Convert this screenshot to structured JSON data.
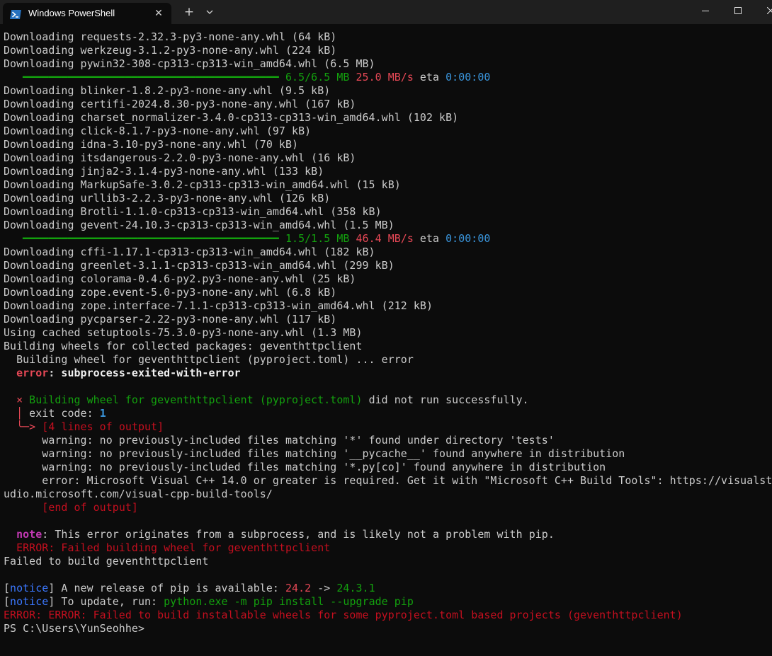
{
  "window": {
    "tab_title": "Windows PowerShell",
    "icons": {
      "tab": "powershell-icon",
      "close": "close-icon",
      "new_tab": "plus-icon",
      "dropdown": "chevron-down-icon",
      "minimize": "minimize-icon",
      "maximize": "maximize-icon",
      "window_close": "close-icon"
    },
    "close_glyph": "✕",
    "new_tab_glyph": "+"
  },
  "colors": {
    "background": "#0c0c0c",
    "titlebar": "#1f1f1f",
    "text": "#cccccc",
    "green": "#13a10e",
    "red": "#e74856",
    "dark_red": "#c50f1f",
    "cyan": "#3a96dd",
    "blue": "#0037da",
    "magenta": "#c239b3"
  },
  "terminal": {
    "lines": [
      [
        {
          "t": "Downloading requests-2.32.3-py3-none-any.whl (64 kB)",
          "c": "default"
        }
      ],
      [
        {
          "t": "Downloading werkzeug-3.1.2-py3-none-any.whl (224 kB)",
          "c": "default"
        }
      ],
      [
        {
          "t": "Downloading pywin32-308-cp313-cp313-win_amd64.whl (6.5 MB)",
          "c": "default"
        }
      ],
      [
        {
          "t": "   ━━━━━━━━━━━━━━━━━━━━━━━━━━━━━━━━━━━━━━━━ ",
          "c": "green"
        },
        {
          "t": "6.5/6.5 MB",
          "c": "green"
        },
        {
          "t": " ",
          "c": "default"
        },
        {
          "t": "25.0 MB/s",
          "c": "red"
        },
        {
          "t": " eta ",
          "c": "default"
        },
        {
          "t": "0:00:00",
          "c": "cyan"
        }
      ],
      [
        {
          "t": "Downloading blinker-1.8.2-py3-none-any.whl (9.5 kB)",
          "c": "default"
        }
      ],
      [
        {
          "t": "Downloading certifi-2024.8.30-py3-none-any.whl (167 kB)",
          "c": "default"
        }
      ],
      [
        {
          "t": "Downloading charset_normalizer-3.4.0-cp313-cp313-win_amd64.whl (102 kB)",
          "c": "default"
        }
      ],
      [
        {
          "t": "Downloading click-8.1.7-py3-none-any.whl (97 kB)",
          "c": "default"
        }
      ],
      [
        {
          "t": "Downloading idna-3.10-py3-none-any.whl (70 kB)",
          "c": "default"
        }
      ],
      [
        {
          "t": "Downloading itsdangerous-2.2.0-py3-none-any.whl (16 kB)",
          "c": "default"
        }
      ],
      [
        {
          "t": "Downloading jinja2-3.1.4-py3-none-any.whl (133 kB)",
          "c": "default"
        }
      ],
      [
        {
          "t": "Downloading MarkupSafe-3.0.2-cp313-cp313-win_amd64.whl (15 kB)",
          "c": "default"
        }
      ],
      [
        {
          "t": "Downloading urllib3-2.2.3-py3-none-any.whl (126 kB)",
          "c": "default"
        }
      ],
      [
        {
          "t": "Downloading Brotli-1.1.0-cp313-cp313-win_amd64.whl (358 kB)",
          "c": "default"
        }
      ],
      [
        {
          "t": "Downloading gevent-24.10.3-cp313-cp313-win_amd64.whl (1.5 MB)",
          "c": "default"
        }
      ],
      [
        {
          "t": "   ━━━━━━━━━━━━━━━━━━━━━━━━━━━━━━━━━━━━━━━━ ",
          "c": "green"
        },
        {
          "t": "1.5/1.5 MB",
          "c": "green"
        },
        {
          "t": " ",
          "c": "default"
        },
        {
          "t": "46.4 MB/s",
          "c": "red"
        },
        {
          "t": " eta ",
          "c": "default"
        },
        {
          "t": "0:00:00",
          "c": "cyan"
        }
      ],
      [
        {
          "t": "Downloading cffi-1.17.1-cp313-cp313-win_amd64.whl (182 kB)",
          "c": "default"
        }
      ],
      [
        {
          "t": "Downloading greenlet-3.1.1-cp313-cp313-win_amd64.whl (299 kB)",
          "c": "default"
        }
      ],
      [
        {
          "t": "Downloading colorama-0.4.6-py2.py3-none-any.whl (25 kB)",
          "c": "default"
        }
      ],
      [
        {
          "t": "Downloading zope.event-5.0-py3-none-any.whl (6.8 kB)",
          "c": "default"
        }
      ],
      [
        {
          "t": "Downloading zope.interface-7.1.1-cp313-cp313-win_amd64.whl (212 kB)",
          "c": "default"
        }
      ],
      [
        {
          "t": "Downloading pycparser-2.22-py3-none-any.whl (117 kB)",
          "c": "default"
        }
      ],
      [
        {
          "t": "Using cached setuptools-75.3.0-py3-none-any.whl (1.3 MB)",
          "c": "default"
        }
      ],
      [
        {
          "t": "Building wheels for collected packages: geventhttpclient",
          "c": "default"
        }
      ],
      [
        {
          "t": "  Building wheel for geventhttpclient (pyproject.toml) ... error",
          "c": "default"
        }
      ],
      [
        {
          "t": "  ",
          "c": "default"
        },
        {
          "t": "error",
          "c": "red",
          "b": true
        },
        {
          "t": ": ",
          "c": "default",
          "b": true
        },
        {
          "t": "subprocess-exited-with-error",
          "c": "white",
          "b": true
        }
      ],
      [
        {
          "t": "",
          "c": "default"
        }
      ],
      [
        {
          "t": "  ",
          "c": "default"
        },
        {
          "t": "×",
          "c": "red"
        },
        {
          "t": " Building wheel for geventhttpclient (pyproject.toml)",
          "c": "green"
        },
        {
          "t": " did not run successfully.",
          "c": "default"
        }
      ],
      [
        {
          "t": "  ",
          "c": "default"
        },
        {
          "t": "│",
          "c": "red"
        },
        {
          "t": " exit code: ",
          "c": "default"
        },
        {
          "t": "1",
          "c": "cyan",
          "b": true
        }
      ],
      [
        {
          "t": "  ",
          "c": "default"
        },
        {
          "t": "╰─>",
          "c": "red"
        },
        {
          "t": " [4 lines of output]",
          "c": "dred"
        }
      ],
      [
        {
          "t": "      warning: no previously-included files matching '*' found under directory 'tests'",
          "c": "default"
        }
      ],
      [
        {
          "t": "      warning: no previously-included files matching '__pycache__' found anywhere in distribution",
          "c": "default"
        }
      ],
      [
        {
          "t": "      warning: no previously-included files matching '*.py[co]' found anywhere in distribution",
          "c": "default"
        }
      ],
      [
        {
          "t": "      error: Microsoft Visual C++ 14.0 or greater is required. Get it with \"Microsoft C++ Build Tools\": https://visualst",
          "c": "default"
        }
      ],
      [
        {
          "t": "udio.microsoft.com/visual-cpp-build-tools/",
          "c": "default"
        }
      ],
      [
        {
          "t": "      ",
          "c": "default"
        },
        {
          "t": "[end of output]",
          "c": "dred"
        }
      ],
      [
        {
          "t": "",
          "c": "default"
        }
      ],
      [
        {
          "t": "  ",
          "c": "default"
        },
        {
          "t": "note",
          "c": "magenta",
          "b": true
        },
        {
          "t": ": This error originates from a subprocess, and is likely not a problem with pip.",
          "c": "default"
        }
      ],
      [
        {
          "t": "  ERROR: Failed building wheel for geventhttpclient",
          "c": "dred"
        }
      ],
      [
        {
          "t": "Failed to build geventhttpclient",
          "c": "default"
        }
      ],
      [
        {
          "t": "",
          "c": "default"
        }
      ],
      [
        {
          "t": "[",
          "c": "default"
        },
        {
          "t": "notice",
          "c": "blue2"
        },
        {
          "t": "] A new release of pip is available: ",
          "c": "default"
        },
        {
          "t": "24.2",
          "c": "red"
        },
        {
          "t": " -> ",
          "c": "default"
        },
        {
          "t": "24.3.1",
          "c": "green"
        }
      ],
      [
        {
          "t": "[",
          "c": "default"
        },
        {
          "t": "notice",
          "c": "blue2"
        },
        {
          "t": "] To update, run: ",
          "c": "default"
        },
        {
          "t": "python.exe -m pip install --upgrade pip",
          "c": "green"
        }
      ],
      [
        {
          "t": "ERROR: ERROR: Failed to build installable wheels for some pyproject.toml based projects (geventhttpclient)",
          "c": "dred"
        }
      ],
      [
        {
          "t": "PS C:\\Users\\YunSeohhe>",
          "c": "default"
        }
      ]
    ]
  }
}
